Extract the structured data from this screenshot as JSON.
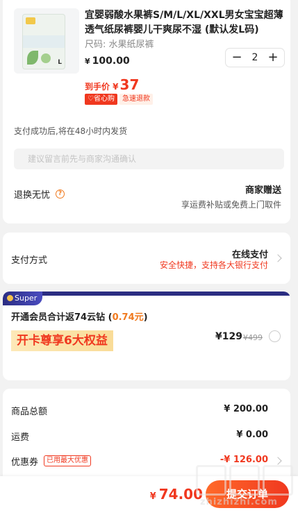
{
  "product": {
    "title": "宜婴弱酸水果裤S/M/L/XL/XXL男女宝宝超薄透气纸尿裤婴儿干爽尿不湿 (默认发L码)",
    "spec": "尺码: 水果纸尿裤",
    "currency": "¥",
    "price": "100.00",
    "quantity": "2",
    "minus": "−",
    "plus": "+",
    "final_price_label": "到手价 ¥",
    "final_price": "37",
    "tags": [
      "♡省心购",
      "急速退款"
    ],
    "package_size_label": "L"
  },
  "shipping_note": "支付成功后,将在48小时内发货",
  "message_placeholder": "建议留言前先与商家沟通确认",
  "return_policy": {
    "label": "退换无忧",
    "help_icon": "?",
    "gift_title": "商家赠送",
    "gift_sub": "享运费补贴或免费上门取件"
  },
  "payment": {
    "label": "支付方式",
    "method": "在线支付",
    "method_sub": "安全快捷，支持各大银行支付"
  },
  "super_member": {
    "badge": "Super",
    "title_prefix": "开通会员合计返74云钻",
    "title_open": " (",
    "title_highlight": "0.74元",
    "title_close": ")",
    "benefit": "开卡尊享6大权益",
    "price": "¥129",
    "orig_price": "¥499"
  },
  "summary": {
    "goods_total_label": "商品总额",
    "goods_total": "¥ 200.00",
    "shipping_label": "运费",
    "shipping": "¥ 0.00",
    "coupon_label": "优惠券",
    "coupon_tag": "已用最大优惠",
    "coupon": "-¥ 126.00"
  },
  "bottom_bar": {
    "currency": "¥",
    "total": "74.00",
    "submit": "提交订单"
  },
  "watermark": "zhizhizhi.com",
  "colors": {
    "accent": "#f0381f",
    "orange": "#f07a1f",
    "super_navy": "#2b2d82"
  }
}
